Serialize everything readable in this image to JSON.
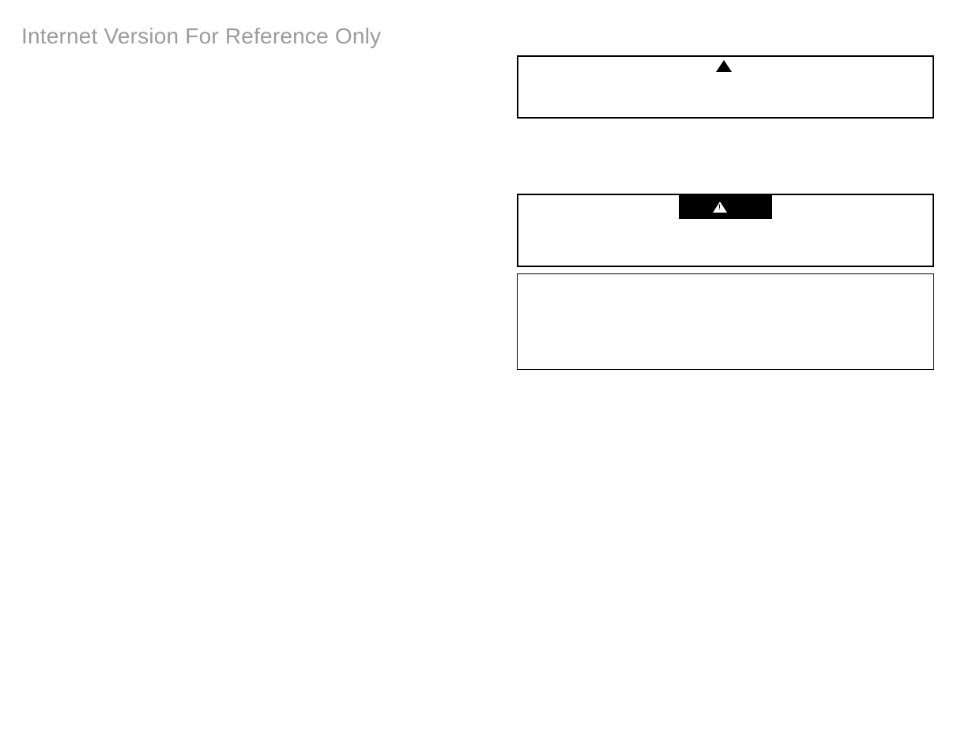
{
  "watermark": "Internet Version For Reference Only",
  "boxes": {
    "box1": {
      "icon": "warning-triangle-solid",
      "label": ""
    },
    "box2": {
      "icon": "warning-triangle-outline",
      "label": ""
    },
    "box3": {
      "icon": null,
      "label": ""
    }
  }
}
